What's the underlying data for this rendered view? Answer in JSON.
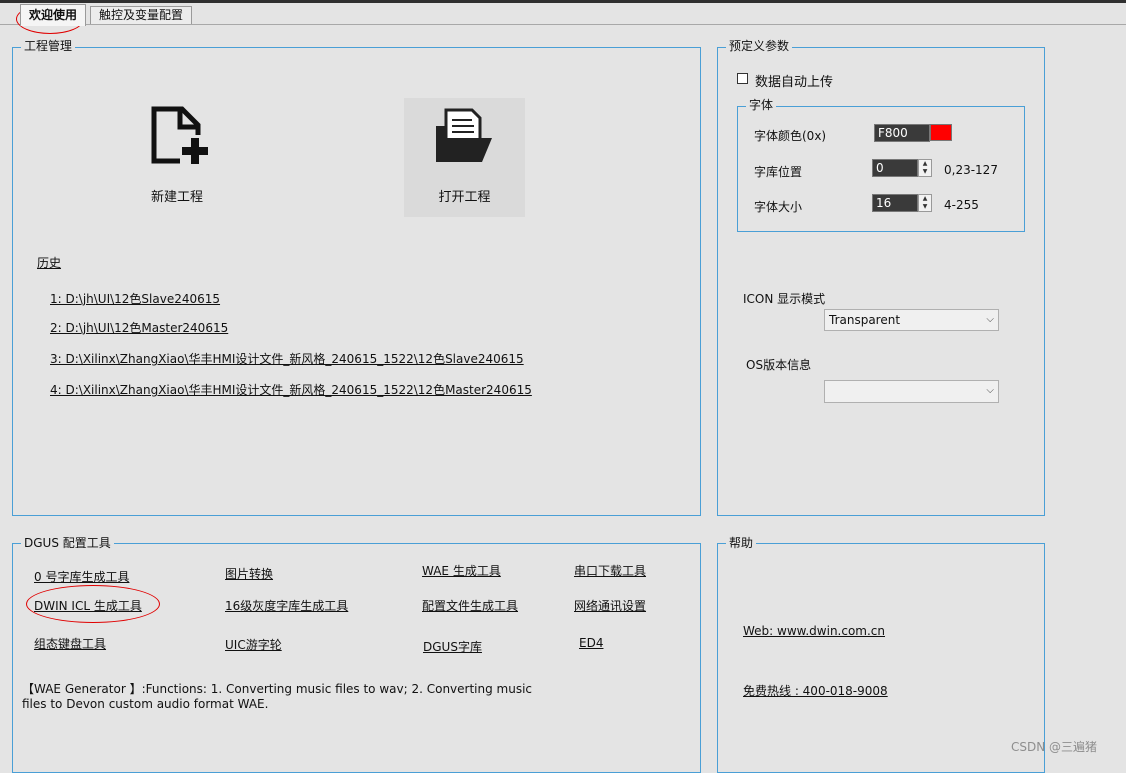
{
  "tabs": [
    {
      "label": "欢迎使用",
      "active": true
    },
    {
      "label": "触控及变量配置",
      "active": false
    }
  ],
  "project": {
    "title": "工程管理",
    "new_label": "新建工程",
    "open_label": "打开工程",
    "history_title": "历史",
    "history": [
      "1:  D:\\jh\\UI\\12色Slave240615",
      "2:  D:\\jh\\UI\\12色Master240615",
      "3:  D:\\Xilinx\\ZhangXiao\\华丰HMI设计文件_新风格_240615_1522\\12色Slave240615",
      "4:  D:\\Xilinx\\ZhangXiao\\华丰HMI设计文件_新风格_240615_1522\\12色Master240615"
    ]
  },
  "predef": {
    "title": "预定义参数",
    "auto_upload_label": "数据自动上传",
    "font_group_title": "字体",
    "font_color_label": "字体颜色(0x)",
    "font_color_value": "F800",
    "font_color_swatch": "#ff0000",
    "font_lib_label": "字库位置",
    "font_lib_value": "0",
    "font_lib_range": "0,23-127",
    "font_size_label": "字体大小",
    "font_size_value": "16",
    "font_size_range": "4-255",
    "icon_mode_label": "ICON 显示模式",
    "icon_mode_value": "Transparent",
    "os_version_label": "OS版本信息",
    "os_version_value": ""
  },
  "tools": {
    "title": "DGUS 配置工具",
    "items": [
      "0 号字库生成工具",
      "图片转换",
      "WAE 生成工具",
      "串口下载工具",
      "DWIN ICL 生成工具",
      "16级灰度字库生成工具",
      "配置文件生成工具",
      "网络通讯设置",
      "组态键盘工具",
      "UIC游字轮",
      "DGUS字库",
      "ED4"
    ],
    "description_line1": "【WAE Generator 】:Functions: 1. Converting music files to wav; 2. Converting music",
    "description_line2": "files to Devon custom audio format WAE."
  },
  "help": {
    "title": "帮助",
    "web": "Web: www.dwin.com.cn",
    "hotline": "免费热线 : 400-018-9008"
  },
  "watermark": "CSDN @三遍猪",
  "colors": {
    "group_border": "#4a9fd6",
    "annotation": "#e00000"
  }
}
